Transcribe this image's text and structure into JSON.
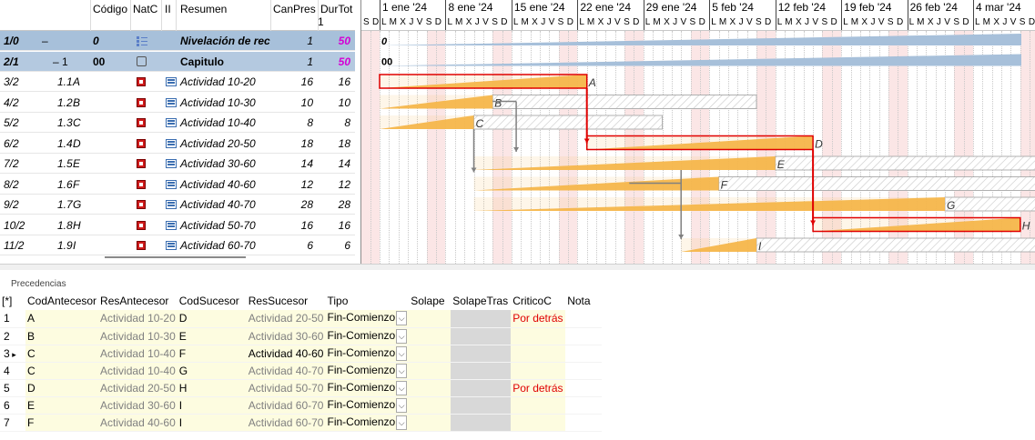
{
  "tree": {
    "headers": {
      "codigo": "Código",
      "natc": "NatC",
      "ii": "II",
      "resumen": "Resumen",
      "canpres": "CanPres",
      "canpres_sub": "1",
      "durtot": "DurTot"
    },
    "rows": [
      {
        "head": "1/0",
        "level": "–",
        "code": "0",
        "natc": "root-icon",
        "res": "Nivelación de rec",
        "can": "1",
        "dur": "50",
        "type": "root"
      },
      {
        "head": "2/1",
        "level": "– 1",
        "code": "00",
        "natc": "chapter-icon",
        "res": "Capitulo",
        "can": "1",
        "dur": "50",
        "type": "chapter"
      },
      {
        "head": "3/2",
        "level": "1.1",
        "code": "A",
        "natc": "task-icon",
        "res": "Actividad 10-20",
        "can": "16",
        "dur": "16",
        "type": "task"
      },
      {
        "head": "4/2",
        "level": "1.2",
        "code": "B",
        "natc": "task-icon",
        "res": "Actividad 10-30",
        "can": "10",
        "dur": "10",
        "type": "task"
      },
      {
        "head": "5/2",
        "level": "1.3",
        "code": "C",
        "natc": "task-icon",
        "res": "Actividad 10-40",
        "can": "8",
        "dur": "8",
        "type": "task"
      },
      {
        "head": "6/2",
        "level": "1.4",
        "code": "D",
        "natc": "task-icon",
        "res": "Actividad 20-50",
        "can": "18",
        "dur": "18",
        "type": "task"
      },
      {
        "head": "7/2",
        "level": "1.5",
        "code": "E",
        "natc": "task-icon",
        "res": "Actividad 30-60",
        "can": "14",
        "dur": "14",
        "type": "task"
      },
      {
        "head": "8/2",
        "level": "1.6",
        "code": "F",
        "natc": "task-icon",
        "res": "Actividad 40-60",
        "can": "12",
        "dur": "12",
        "type": "task"
      },
      {
        "head": "9/2",
        "level": "1.7",
        "code": "G",
        "natc": "task-icon",
        "res": "Actividad 40-70",
        "can": "28",
        "dur": "28",
        "type": "task"
      },
      {
        "head": "10/2",
        "level": "1.8",
        "code": "H",
        "natc": "task-icon",
        "res": "Actividad 50-70",
        "can": "16",
        "dur": "16",
        "type": "task"
      },
      {
        "head": "11/2",
        "level": "1.9",
        "code": "I",
        "natc": "task-icon",
        "res": "Actividad 60-70",
        "can": "6",
        "dur": "6",
        "type": "task"
      }
    ]
  },
  "gantt": {
    "weeks": [
      "1 ene '24",
      "8 ene '24",
      "15 ene '24",
      "22 ene '24",
      "29 ene '24",
      "5 feb '24",
      "12 feb '24",
      "19 feb '24",
      "26 feb '24",
      "4 mar '24"
    ],
    "days_leading": "S D",
    "days_pattern": "L M X J V S D",
    "row_labels": [
      "0",
      "00"
    ]
  },
  "precedencias": {
    "title": "Precedencias",
    "columns": [
      "[*]",
      "CodAntecesor",
      "ResAntecesor",
      "CodSucesor",
      "ResSucesor",
      "Tipo",
      "Solape",
      "SolapeTras",
      "CriticoC",
      "Nota"
    ],
    "rows": [
      {
        "idx": "1",
        "ca": "A",
        "ra": "Actividad 10-20",
        "cs": "D",
        "rs": "Actividad 20-50",
        "tipo": "Fin-Comienzo",
        "critico": "Por detrás"
      },
      {
        "idx": "2",
        "ca": "B",
        "ra": "Actividad 10-30",
        "cs": "E",
        "rs": "Actividad 30-60",
        "tipo": "Fin-Comienzo",
        "critico": ""
      },
      {
        "idx": "3",
        "ca": "C",
        "ra": "Actividad 10-40",
        "cs": "F",
        "rs": "Actividad 40-60",
        "tipo": "Fin-Comienzo",
        "critico": "",
        "selected": true
      },
      {
        "idx": "4",
        "ca": "C",
        "ra": "Actividad 10-40",
        "cs": "G",
        "rs": "Actividad 40-70",
        "tipo": "Fin-Comienzo",
        "critico": ""
      },
      {
        "idx": "5",
        "ca": "D",
        "ra": "Actividad 20-50",
        "cs": "H",
        "rs": "Actividad 50-70",
        "tipo": "Fin-Comienzo",
        "critico": "Por detrás"
      },
      {
        "idx": "6",
        "ca": "E",
        "ra": "Actividad 30-60",
        "cs": "I",
        "rs": "Actividad 60-70",
        "tipo": "Fin-Comienzo",
        "critico": ""
      },
      {
        "idx": "7",
        "ca": "F",
        "ra": "Actividad 40-60",
        "cs": "I",
        "rs": "Actividad 60-70",
        "tipo": "Fin-Comienzo",
        "critico": ""
      }
    ]
  },
  "colors": {
    "root_band": "#a7c0da",
    "chapter_band": "#b4c9e0",
    "bar": "#f6b74c",
    "critical": "#e00000",
    "gray": "#808080"
  }
}
